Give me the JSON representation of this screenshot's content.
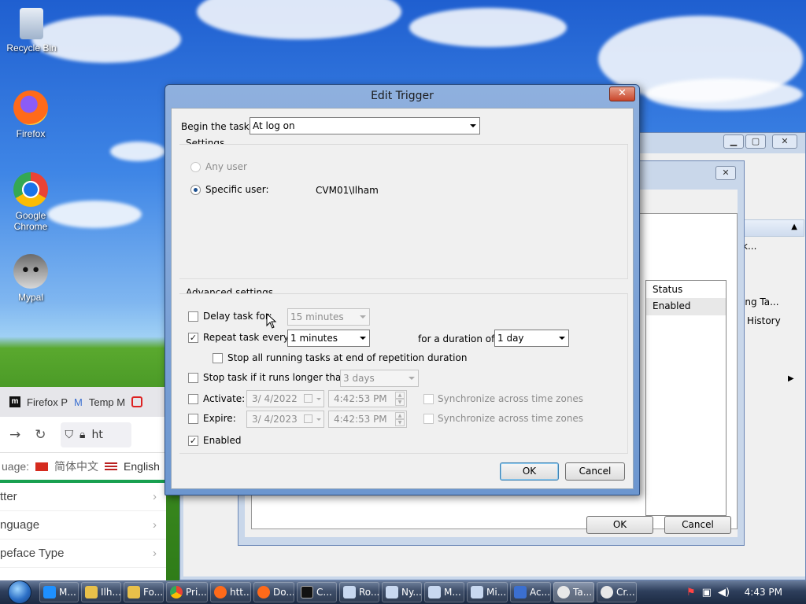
{
  "desktop": {
    "icons": [
      {
        "label": "Recycle Bin",
        "icon": "recycle-bin-icon"
      },
      {
        "label": "Firefox",
        "icon": "firefox-icon"
      },
      {
        "label": "Google Chrome",
        "icon": "chrome-icon"
      },
      {
        "label": "Mypal",
        "icon": "mypal-icon"
      }
    ]
  },
  "browser": {
    "tabs": [
      "Firefox P",
      "Temp M"
    ],
    "url_partial": "ht",
    "language_prefix": "uage:",
    "lang_chinese": "简体中文",
    "lang_english": "English",
    "menu_items": [
      "tter",
      "nguage",
      "peface Type"
    ]
  },
  "bg_window": {
    "column_status": "Status",
    "row_status": "Enabled",
    "side_items": [
      "k...",
      "ing Ta...",
      "History"
    ],
    "ok_label": "OK",
    "cancel_label": "Cancel"
  },
  "dialog": {
    "title": "Edit Trigger",
    "begin_label": "Begin the task:",
    "begin_value": "At log on",
    "settings_title": "Settings",
    "any_user": "Any user",
    "specific_user": "Specific user:",
    "user_value": "CVM01\\Ilham",
    "advanced_title": "Advanced settings",
    "delay_label": "Delay task for:",
    "delay_value": "15 minutes",
    "repeat_label": "Repeat task every:",
    "repeat_value": "1 minutes",
    "duration_label": "for a duration of:",
    "duration_value": "1 day",
    "stop_all_label": "Stop all running tasks at end of repetition duration",
    "stop_longer_label": "Stop task if it runs longer than:",
    "stop_longer_value": "3 days",
    "activate_label": "Activate:",
    "activate_date": "3/  4/2022",
    "activate_time": "4:42:53 PM",
    "expire_label": "Expire:",
    "expire_date": "3/  4/2023",
    "expire_time": "4:42:53 PM",
    "sync_label": "Synchronize across time zones",
    "enabled_label": "Enabled",
    "ok_label": "OK",
    "cancel_label": "Cancel"
  },
  "taskbar": {
    "items": [
      "M...",
      "Ilh...",
      "Fo...",
      "Pri...",
      "htt...",
      "Do...",
      "C...",
      "Ro...",
      "Ny...",
      "M...",
      "Mi...",
      "Ac...",
      "Ta...",
      "Cr..."
    ],
    "clock": "4:43 PM"
  }
}
